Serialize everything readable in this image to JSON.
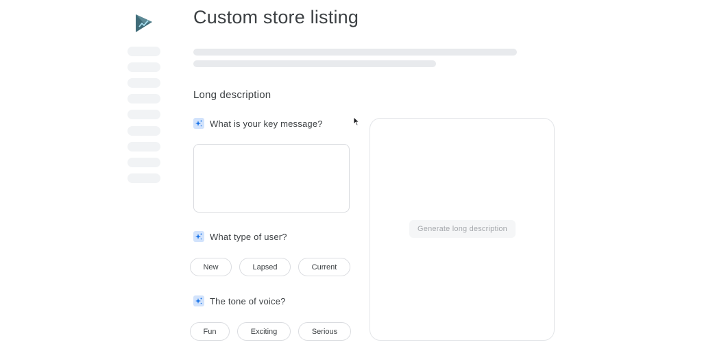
{
  "header": {
    "title": "Custom store listing"
  },
  "sidebar": {
    "logo_icon": "google-play-console-logo-icon"
  },
  "section": {
    "title": "Long description"
  },
  "questions": {
    "key_message": "What is your key message?",
    "user_type": "What type of user?",
    "tone": "The tone of voice?"
  },
  "user_type_chips": [
    "New",
    "Lapsed",
    "Current"
  ],
  "tone_chips": [
    "Fun",
    "Exciting",
    "Serious"
  ],
  "preview": {
    "generate_label": "Generate long description"
  },
  "colors": {
    "accent_icon_bg": "#d2e3fc",
    "accent_icon_fg": "#1a73e8",
    "logo_primary": "#3f6b78",
    "border": "#dadce0",
    "skeleton": "#e8eaed"
  }
}
